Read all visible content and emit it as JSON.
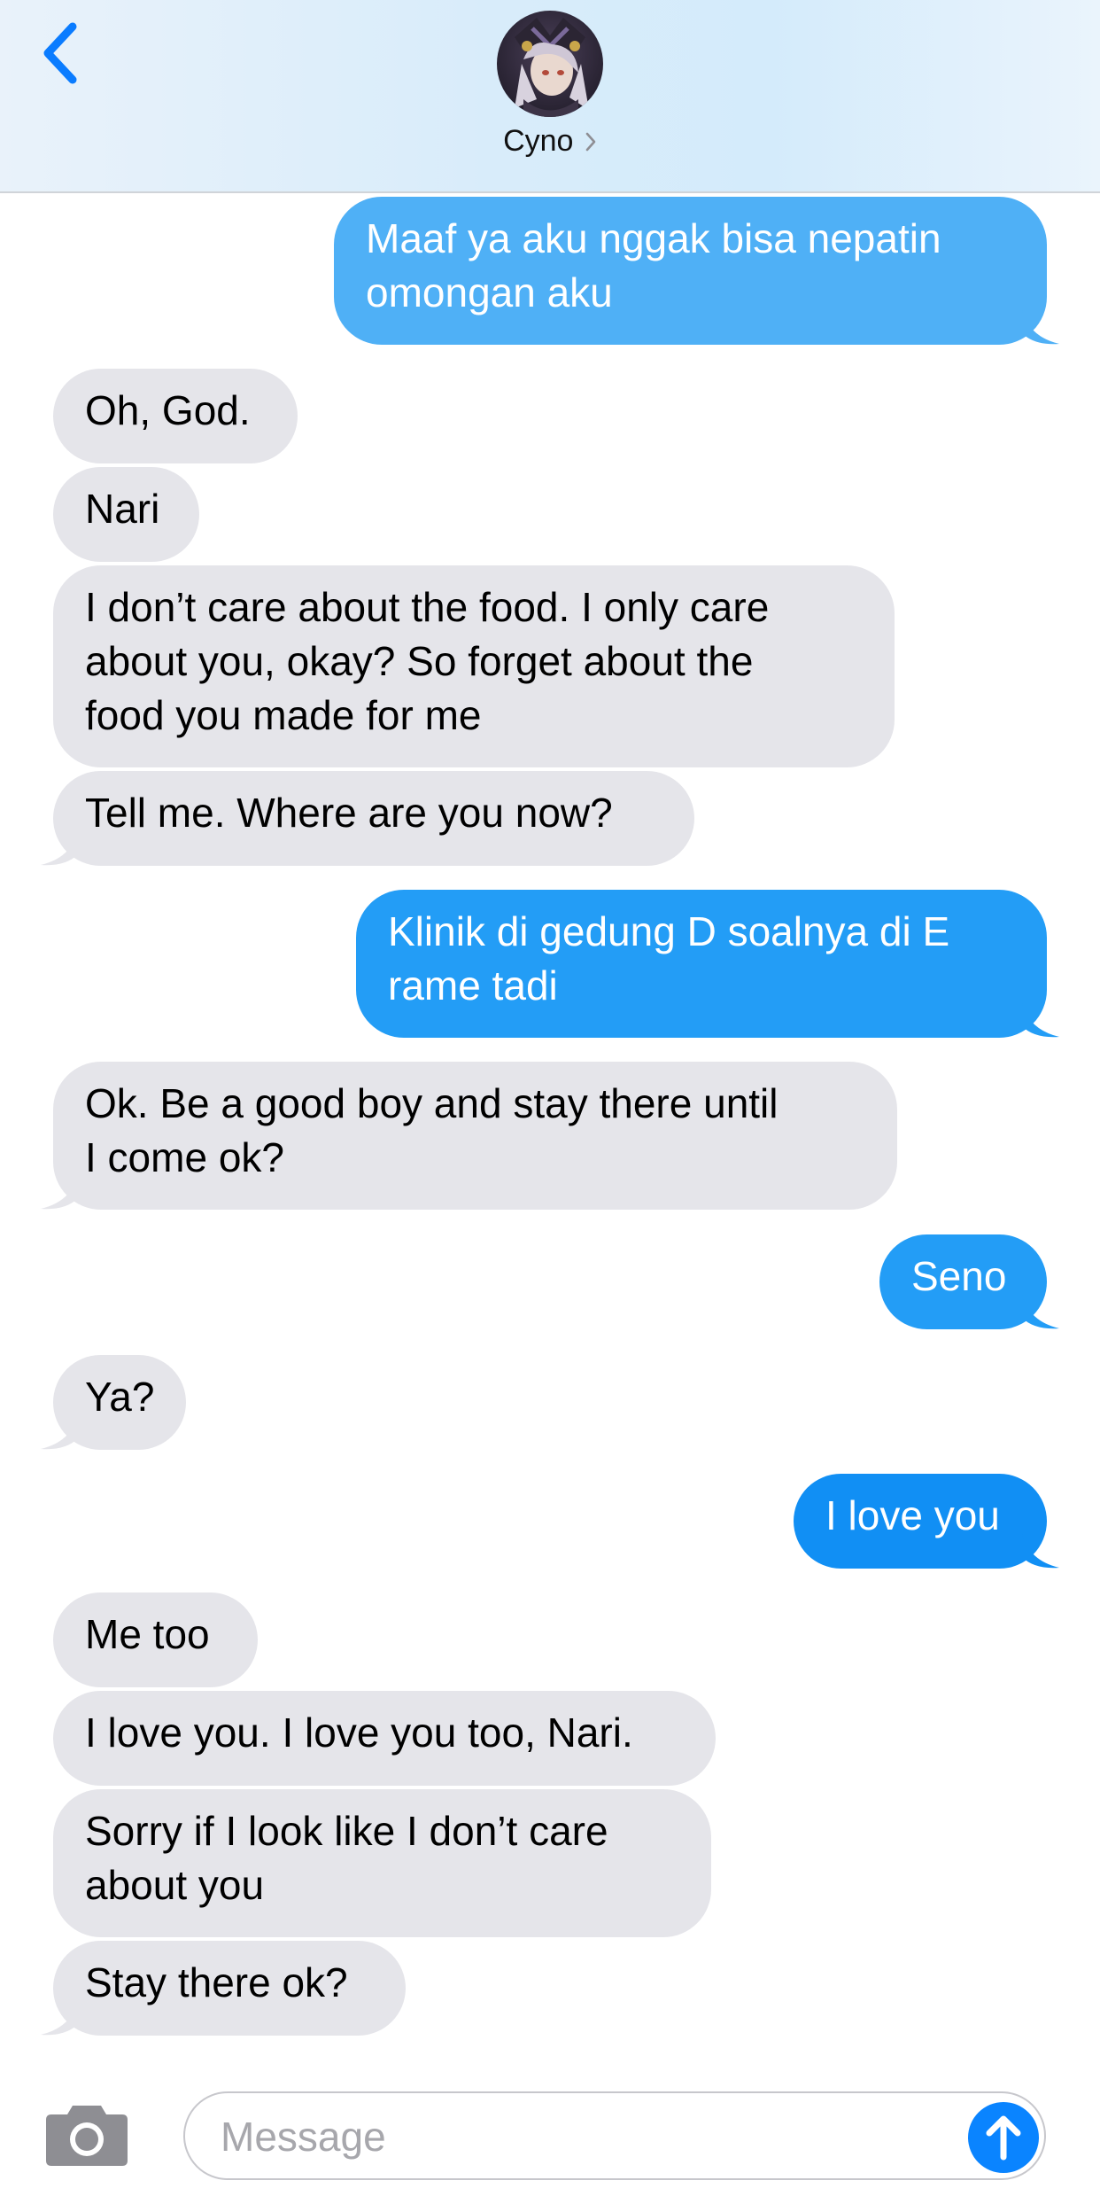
{
  "header": {
    "contact_name": "Cyno",
    "back_icon": "chevron-left-icon",
    "chevron_icon": "chevron-right-icon"
  },
  "colors": {
    "received_bubble": "#e5e5ea",
    "sent_bubble_top": "#4fb0f6",
    "sent_bubble_mid": "#239df6",
    "sent_bubble_bottom": "#118ff4",
    "accent": "#0a84ff"
  },
  "messages": [
    {
      "from": "me",
      "text": "Maaf ya aku nggak bisa nepatin\nomongan aku"
    },
    {
      "from": "them",
      "text": "Oh, God."
    },
    {
      "from": "them",
      "text": "Nari"
    },
    {
      "from": "them",
      "text": "I don’t care about the food. I only care\nabout you, okay? So forget about the\nfood you made for me"
    },
    {
      "from": "them",
      "text": "Tell me. Where are you now?"
    },
    {
      "from": "me",
      "text": "Klinik di gedung D soalnya di E\nrame tadi"
    },
    {
      "from": "them",
      "text": "Ok. Be a good boy and stay there until\nI come ok?"
    },
    {
      "from": "me",
      "text": "Seno"
    },
    {
      "from": "them",
      "text": "Ya?"
    },
    {
      "from": "me",
      "text": "I love you"
    },
    {
      "from": "them",
      "text": "Me too"
    },
    {
      "from": "them",
      "text": "I love you. I love you too, Nari."
    },
    {
      "from": "them",
      "text": "Sorry if I look like I don’t care\nabout you"
    },
    {
      "from": "them",
      "text": "Stay there ok?"
    }
  ],
  "composer": {
    "placeholder": "Message",
    "value": "",
    "camera_icon": "camera-icon",
    "send_icon": "arrow-up-icon"
  }
}
